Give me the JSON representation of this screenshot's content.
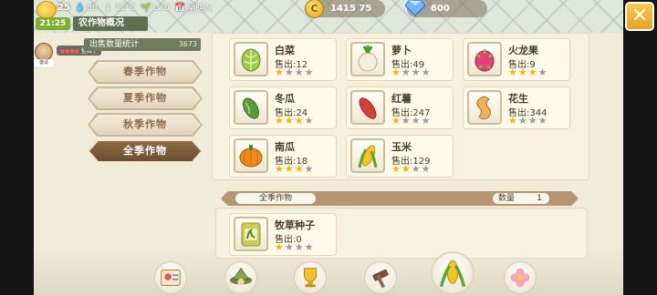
{
  "status": {
    "level": "25",
    "time": "21:25",
    "weather_value": "88",
    "temperature": "11°C",
    "farm_level": "Lv.0",
    "weekday": "星期六"
  },
  "tab_title": "农作物概况",
  "currency": {
    "gold": "1415 75",
    "diamond": "600"
  },
  "close_label": "✕",
  "chat": {
    "avatar_tag": "邀请",
    "name": "●●●●",
    "message": "登陆了"
  },
  "harvest": {
    "title": "出售数量统计",
    "total": "3673"
  },
  "seasons": [
    {
      "label": "春季作物",
      "active": false
    },
    {
      "label": "夏季作物",
      "active": false
    },
    {
      "label": "秋季作物",
      "active": false
    },
    {
      "label": "全季作物",
      "active": true
    }
  ],
  "crops": [
    {
      "name": "白菜",
      "sale_label": "售出",
      "sold": "12",
      "stars": 1,
      "icon": "cabbage-icon"
    },
    {
      "name": "萝卜",
      "sale_label": "售出",
      "sold": "49",
      "stars": 1,
      "icon": "radish-icon"
    },
    {
      "name": "火龙果",
      "sale_label": "售出",
      "sold": "9",
      "stars": 3,
      "icon": "dragonfruit-icon"
    },
    {
      "name": "冬瓜",
      "sale_label": "售出",
      "sold": "24",
      "stars": 3,
      "icon": "wintermelon-icon"
    },
    {
      "name": "红薯",
      "sale_label": "售出",
      "sold": "247",
      "stars": 1,
      "icon": "sweetpotato-icon"
    },
    {
      "name": "花生",
      "sale_label": "售出",
      "sold": "344",
      "stars": 1,
      "icon": "peanut-icon"
    },
    {
      "name": "南瓜",
      "sale_label": "售出",
      "sold": "18",
      "stars": 3,
      "icon": "pumpkin-icon"
    },
    {
      "name": "玉米",
      "sale_label": "售出",
      "sold": "129",
      "stars": 2,
      "icon": "corn-icon"
    }
  ],
  "seed_section": {
    "category": "全季作物",
    "qty_label": "数量",
    "qty_value": "1",
    "item": {
      "name": "牧草种子",
      "sale_label": "售出",
      "sold": "0",
      "stars": 1,
      "icon": "grass-seed-icon"
    }
  },
  "bottom_nav": [
    {
      "icon": "profile-card-icon"
    },
    {
      "icon": "farmer-hat-icon"
    },
    {
      "icon": "trophy-icon"
    },
    {
      "icon": "tools-icon"
    },
    {
      "icon": "corn-crop-icon"
    },
    {
      "icon": "flower-icon"
    }
  ],
  "colors": {
    "accent_brown": "#6c4e31",
    "star_on": "#f4b400",
    "close_orange": "#e9a126"
  }
}
